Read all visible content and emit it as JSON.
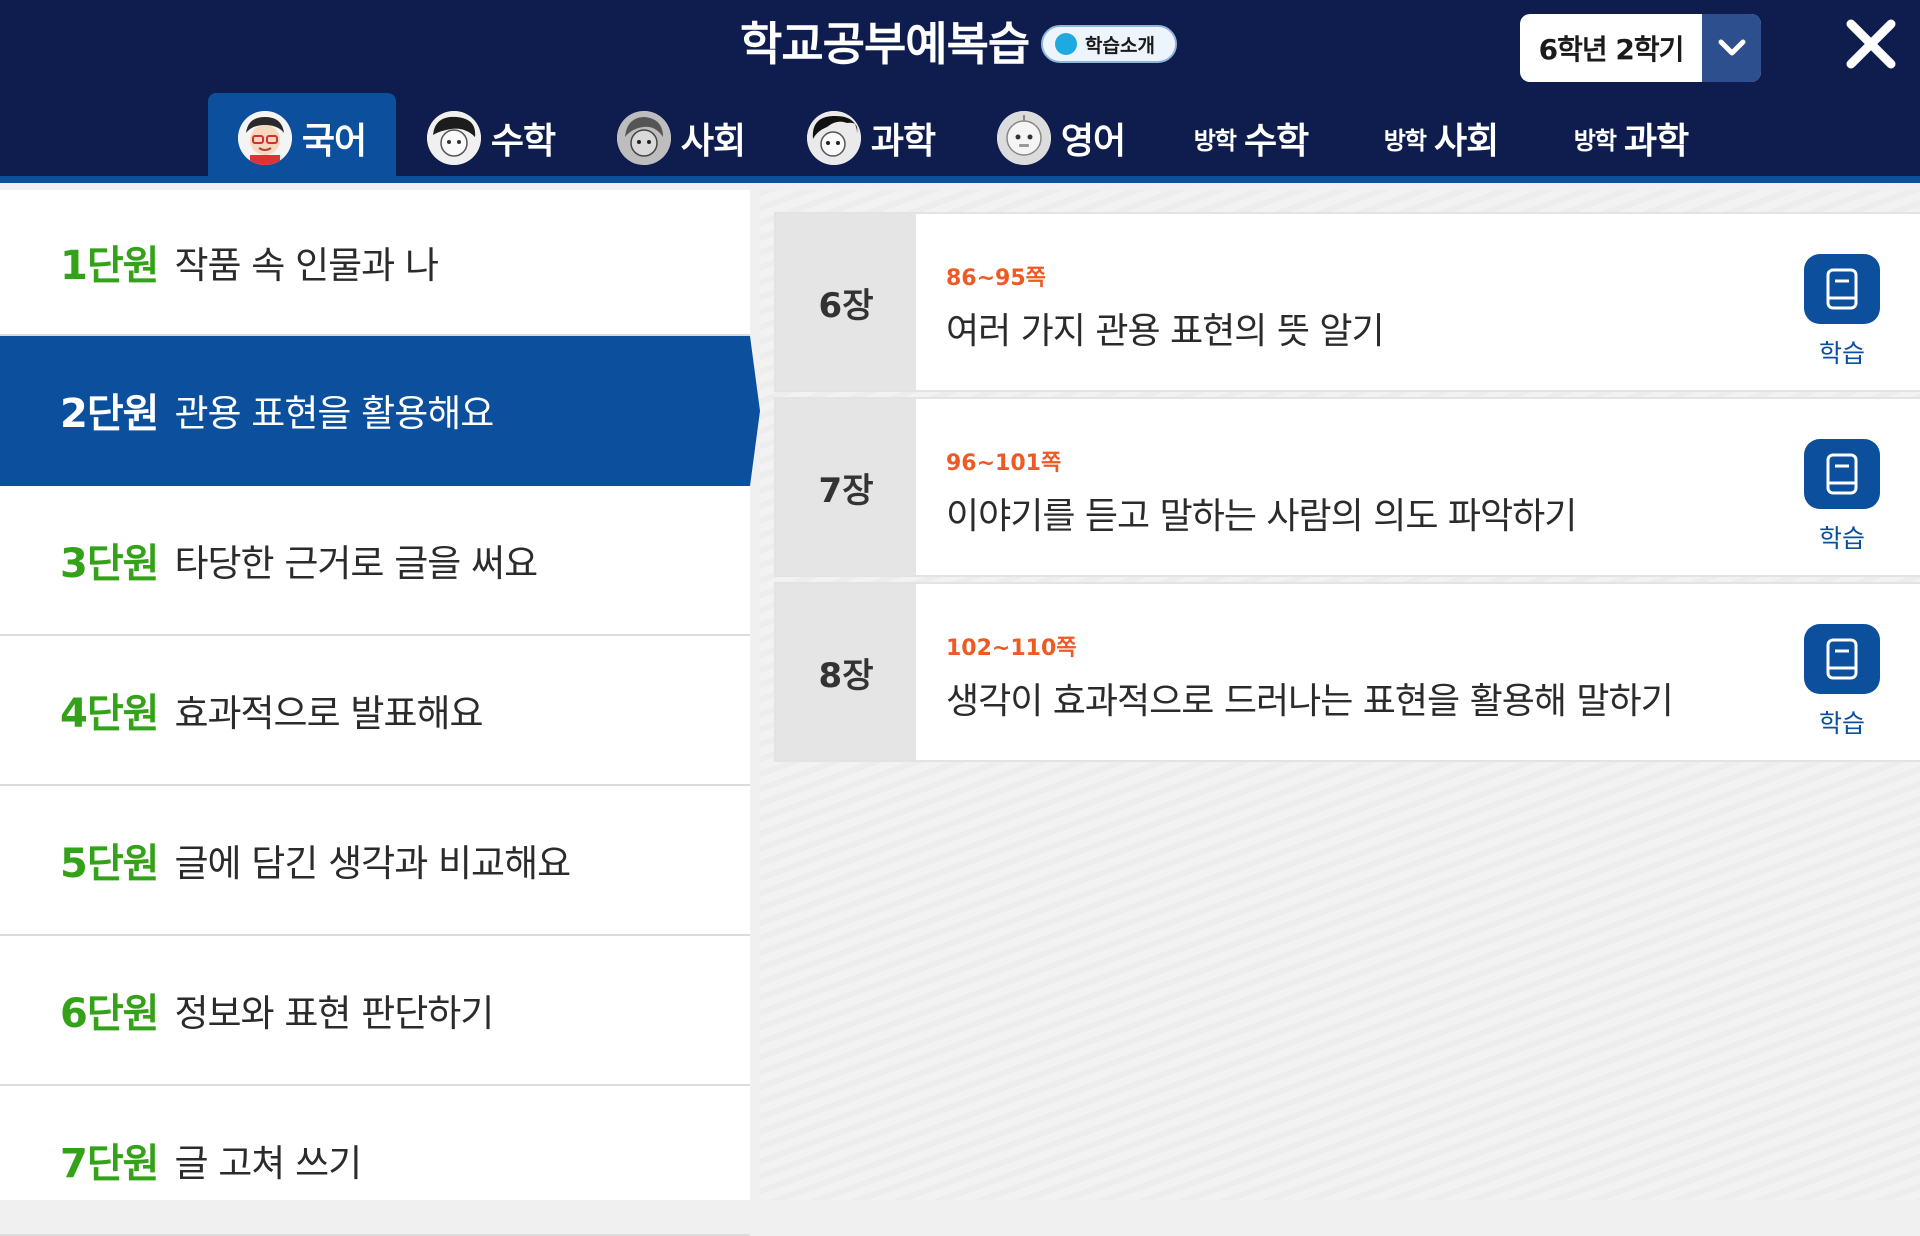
{
  "header": {
    "title": "학교공부예복습",
    "intro_badge": "학습소개",
    "grade_label": "6학년 2학기"
  },
  "tabs": [
    {
      "label": "국어",
      "active": true
    },
    {
      "label": "수학"
    },
    {
      "label": "사회"
    },
    {
      "label": "과학"
    },
    {
      "label": "영어"
    },
    {
      "prefix": "방학",
      "label": "수학"
    },
    {
      "prefix": "방학",
      "label": "사회"
    },
    {
      "prefix": "방학",
      "label": "과학"
    }
  ],
  "units": [
    {
      "num": "1단원",
      "title": "작품 속 인물과 나"
    },
    {
      "num": "2단원",
      "title": "관용 표현을 활용해요",
      "active": true
    },
    {
      "num": "3단원",
      "title": "타당한 근거로 글을 써요"
    },
    {
      "num": "4단원",
      "title": "효과적으로 발표해요"
    },
    {
      "num": "5단원",
      "title": "글에 담긴 생각과 비교해요"
    },
    {
      "num": "6단원",
      "title": "정보와 표현 판단하기"
    },
    {
      "num": "7단원",
      "title": "글 고쳐 쓰기"
    }
  ],
  "lessons": [
    {
      "chapter": "6장",
      "pages": "86~95쪽",
      "title": "여러 가지 관용 표현의 뜻 알기",
      "action": "학습"
    },
    {
      "chapter": "7장",
      "pages": "96~101쪽",
      "title": "이야기를 듣고 말하는 사람의 의도 파악하기",
      "action": "학습"
    },
    {
      "chapter": "8장",
      "pages": "102~110쪽",
      "title": "생각이 효과적으로 드러나는 표현을 활용해 말하기",
      "action": "학습"
    }
  ],
  "colors": {
    "navy": "#0e1d4e",
    "accent_blue": "#0b4f9d",
    "unit_green": "#34a218",
    "page_orange": "#ee5a24"
  },
  "icons": [
    "chevron-down-icon",
    "close-icon",
    "book-icon",
    "character-avatar-icon"
  ]
}
